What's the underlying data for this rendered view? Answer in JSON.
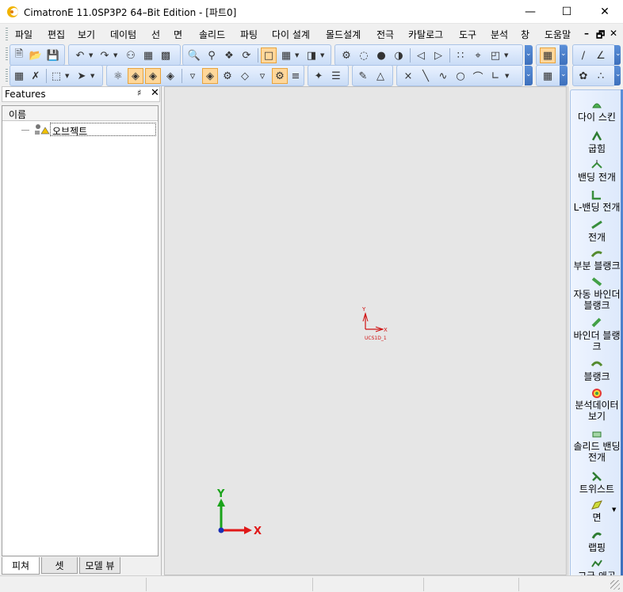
{
  "window": {
    "title": "CimatronE 11.0SP3P2 64–Bit Edition - [파트0]"
  },
  "menu": {
    "items": [
      "파일",
      "편집",
      "보기",
      "데이텀",
      "선",
      "면",
      "솔리드",
      "파팅",
      "다이 설계",
      "몰드설계",
      "전극",
      "카탈로그",
      "도구",
      "분석",
      "창",
      "도움말"
    ],
    "mdi_controls": [
      "–",
      "🗗",
      "✕"
    ]
  },
  "features_panel": {
    "title": "Features",
    "column_header": "이름",
    "tree_items": [
      {
        "label": "오브젝트"
      }
    ],
    "tabs": [
      {
        "label": "피쳐",
        "active": true
      },
      {
        "label": "셋",
        "active": false
      },
      {
        "label": "모델 뷰",
        "active": false
      }
    ]
  },
  "viewport": {
    "ucs_label": "UCS1D_1",
    "ucs_axis_x": "X",
    "ucs_axis_y": "Y",
    "triad_x": "X",
    "triad_y": "Y"
  },
  "right_panel": {
    "buttons": [
      {
        "label": "다이 스킨",
        "icon": "die-skin-icon"
      },
      {
        "label": "굽힘",
        "icon": "bend-icon"
      },
      {
        "label": "밴딩 전개",
        "icon": "bending-unfold-icon"
      },
      {
        "label": "L-밴딩 전개",
        "icon": "l-bending-unfold-icon"
      },
      {
        "label": "전개",
        "icon": "unfold-icon"
      },
      {
        "label": "부분 블랭크",
        "icon": "partial-blank-icon"
      },
      {
        "label": "자동 바인더 블랭크",
        "icon": "auto-binder-blank-icon"
      },
      {
        "label": "바인더 블랭크",
        "icon": "binder-blank-icon"
      },
      {
        "label": "블랭크",
        "icon": "blank-icon"
      },
      {
        "label": "분석데이터 보기",
        "icon": "analysis-data-icon"
      },
      {
        "label": "솔리드 밴딩 전개",
        "icon": "solid-bending-unfold-icon"
      },
      {
        "label": "트위스트",
        "icon": "twist-icon"
      },
      {
        "label": "면",
        "icon": "face-icon"
      },
      {
        "label": "랩핑",
        "icon": "wrapping-icon"
      },
      {
        "label": "고급 왜곡",
        "icon": "advanced-distortion-icon"
      }
    ]
  },
  "colors": {
    "accent": "#3d70bc",
    "viewport_bg": "#e6e6e6",
    "ucs_red": "#d01010",
    "triad_green": "#1aa31a",
    "triad_red": "#e01818",
    "triad_blue": "#1a2fb5"
  }
}
